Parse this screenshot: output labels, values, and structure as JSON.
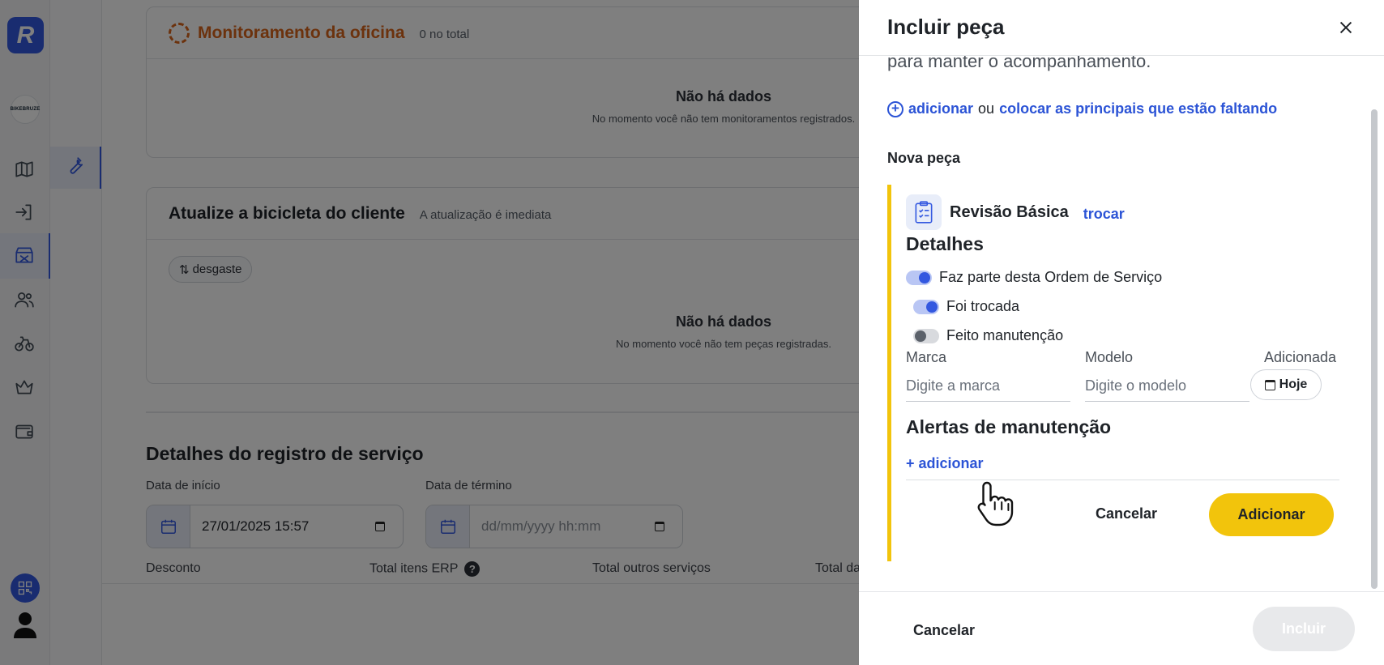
{
  "rail": {
    "logo_letter": "R",
    "brand_text": "BIKEBRUZE",
    "accent": "#3358e0",
    "icons": [
      "map-icon",
      "login-icon",
      "store-icon",
      "users-icon",
      "bicycle-icon",
      "crown-icon",
      "wallet-icon",
      "qr-code-icon",
      "user-icon"
    ]
  },
  "subnav": {
    "icons": [
      "wrench-icon"
    ]
  },
  "main": {
    "monitor_card": {
      "title": "Monitoramento da oficina",
      "count": "0 no total",
      "empty_title": "Não há dados",
      "empty_sub": "No momento você não tem monitoramentos registrados."
    },
    "bike_card": {
      "title": "Atualize a bicicleta do cliente",
      "subtitle": "A atualização é imediata",
      "chip": "desgaste",
      "empty_title": "Não há dados",
      "empty_sub": "No momento você não tem peças registradas."
    },
    "service": {
      "title": "Detalhes do registro de serviço",
      "start_label": "Data de início",
      "start_value": "27/01/2025 15:57",
      "end_label": "Data de término",
      "end_placeholder": "dd/mm/yyyy hh:mm",
      "bottom_labels": [
        "Desconto",
        "Total itens ERP",
        "Total outros serviços",
        "Total da"
      ]
    }
  },
  "drawer": {
    "title": "Incluir peça",
    "cut_text": "para manter o acompanhamento.",
    "add_link": "adicionar",
    "or_text": "ou",
    "missing_link": "colocar as principais que estão faltando",
    "new_part_label": "Nova peça",
    "part": {
      "name": "Revisão Básica",
      "swap": "trocar",
      "details_title": "Detalhes",
      "toggles": [
        {
          "label": "Faz parte desta Ordem de Serviço",
          "on": true
        },
        {
          "label": "Foi trocada",
          "on": true
        },
        {
          "label": "Feito manutenção",
          "on": false
        }
      ],
      "brand_label": "Marca",
      "brand_placeholder": "Digite a marca",
      "model_label": "Modelo",
      "model_placeholder": "Digite o modelo",
      "added_label": "Adicionada",
      "added_value": "Hoje",
      "alerts_title": "Alertas de manutenção",
      "add_alert": "+ adicionar",
      "cancel": "Cancelar",
      "confirm": "Adicionar"
    },
    "footer": {
      "cancel": "Cancelar",
      "submit": "Incluir"
    },
    "accent_yellow": "#f2c40c"
  }
}
